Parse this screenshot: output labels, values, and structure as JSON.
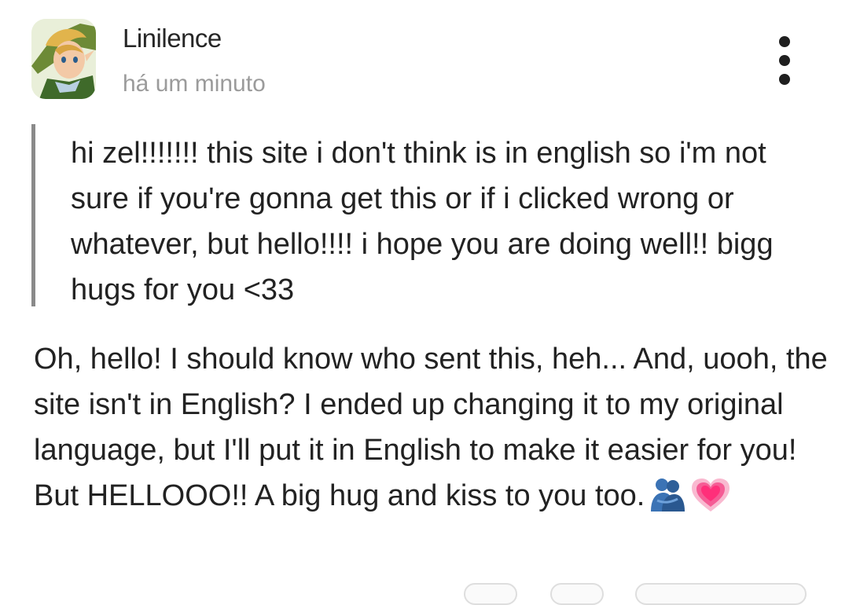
{
  "post": {
    "author": "Linilence",
    "timestamp": "há um minuto",
    "question": "hi zel!!!!!!! this site i don't think is in english so i'm not sure if you're gonna get this or if i clicked wrong or whatever, but hello!!!! i hope you are doing well!! bigg hugs for you <33",
    "answer": "Oh, hello! I should know who sent this, heh... And, uooh, the site isn't in English? I ended up changing it to my original language, but I'll put it in English to make it easier for you! But HELLOOO!! A big hug and kiss to you too.",
    "answer_emojis": [
      "people-hugging-icon",
      "growing-heart-icon"
    ]
  },
  "icons": {
    "menu": "more-vertical-icon"
  },
  "colors": {
    "text": "#222222",
    "muted": "#9b9b9b",
    "quote_bar": "#8a8a8a"
  }
}
